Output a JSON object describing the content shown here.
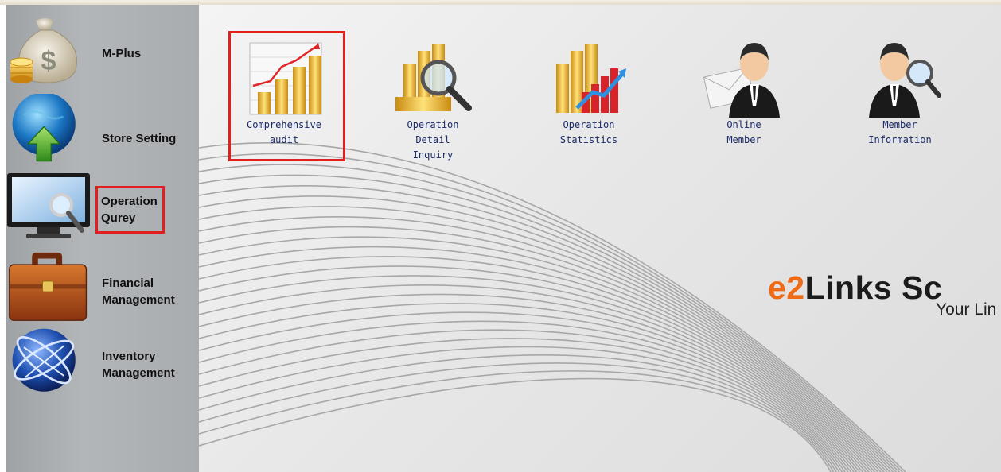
{
  "sidebar": {
    "items": [
      {
        "label": "M-Plus",
        "icon": "money-bag-icon"
      },
      {
        "label": "Store Setting",
        "icon": "globe-upload-icon"
      },
      {
        "label": "Operation\nQurey",
        "icon": "monitor-search-icon"
      },
      {
        "label": "Financial\nManagement",
        "icon": "briefcase-icon"
      },
      {
        "label": "Inventory\nManagement",
        "icon": "globe-network-icon"
      }
    ]
  },
  "main": {
    "tiles": [
      {
        "label": "Comprehensive\naudit",
        "icon": "chart-coins-icon"
      },
      {
        "label": "Operation\nDetail\nInquiry",
        "icon": "coins-magnifier-icon"
      },
      {
        "label": "Operation\nStatistics",
        "icon": "coins-bar-chart-icon"
      },
      {
        "label": "Online\nMember",
        "icon": "member-envelope-icon"
      },
      {
        "label": "Member\nInformation",
        "icon": "member-search-icon"
      }
    ],
    "brand": {
      "prefix": "e2",
      "name": "Links Sc"
    },
    "tagline": "Your Lin"
  },
  "colors": {
    "highlight": "#e02020",
    "brand_accent": "#ef6a14",
    "label_text": "#1a2a6a"
  }
}
